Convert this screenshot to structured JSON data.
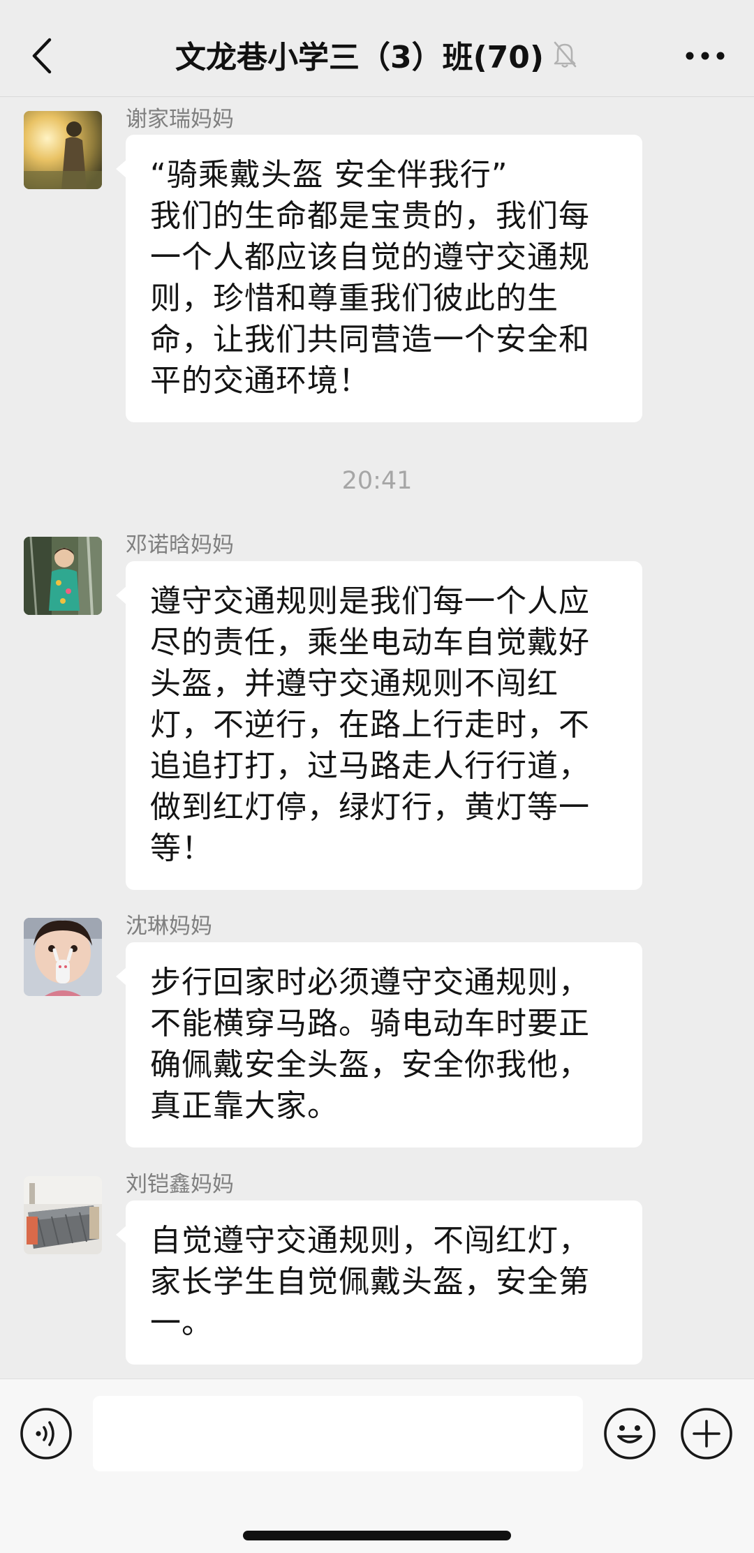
{
  "header": {
    "title": "文龙巷小学三（3）班(70)",
    "back_icon": "chevron-left-icon",
    "mute_icon": "bell-slash-icon",
    "more_icon": "ellipsis-icon"
  },
  "messages": [
    {
      "sender": "谢家瑞妈妈",
      "lines": [
        "“骑乘戴头盔 安全伴我行”",
        "我们的生命都是宝贵的，我们每",
        "一个人都应该自觉的遵守交通规",
        "则，珍惜和尊重我们彼此的生",
        "命，让我们共同营造一个安全和",
        "平的交通环境！"
      ]
    },
    {
      "sender": "邓诺晗妈妈",
      "lines": [
        "遵守交通规则是我们每一个人应",
        "尽的责任，乘坐电动车自觉戴好",
        "头盔，并遵守交通规则不闯红",
        "灯，不逆行，在路上行走时，不",
        "追追打打，过马路走人行行道，",
        "做到红灯停，绿灯行，黄灯等一",
        "等！"
      ]
    },
    {
      "sender": "沈琳妈妈",
      "lines": [
        "步行回家时必须遵守交通规则，",
        "不能横穿马路。骑电动车时要正",
        "确佩戴安全头盔，安全你我他，",
        "真正靠大家。"
      ]
    },
    {
      "sender": "刘铠鑫妈妈",
      "lines": [
        "自觉遵守交通规则，不闯红灯，",
        "家长学生自觉佩戴头盔，安全第",
        "一。"
      ]
    }
  ],
  "timestamp": "20:41",
  "input_bar": {
    "voice_icon": "voice-icon",
    "emoji_icon": "emoji-smile-icon",
    "plus_icon": "plus-circle-icon",
    "input_value": ""
  },
  "colors": {
    "background": "#ededed",
    "bubble": "#ffffff",
    "sender": "#7f7f7f",
    "timestamp": "#a6a6a6"
  }
}
